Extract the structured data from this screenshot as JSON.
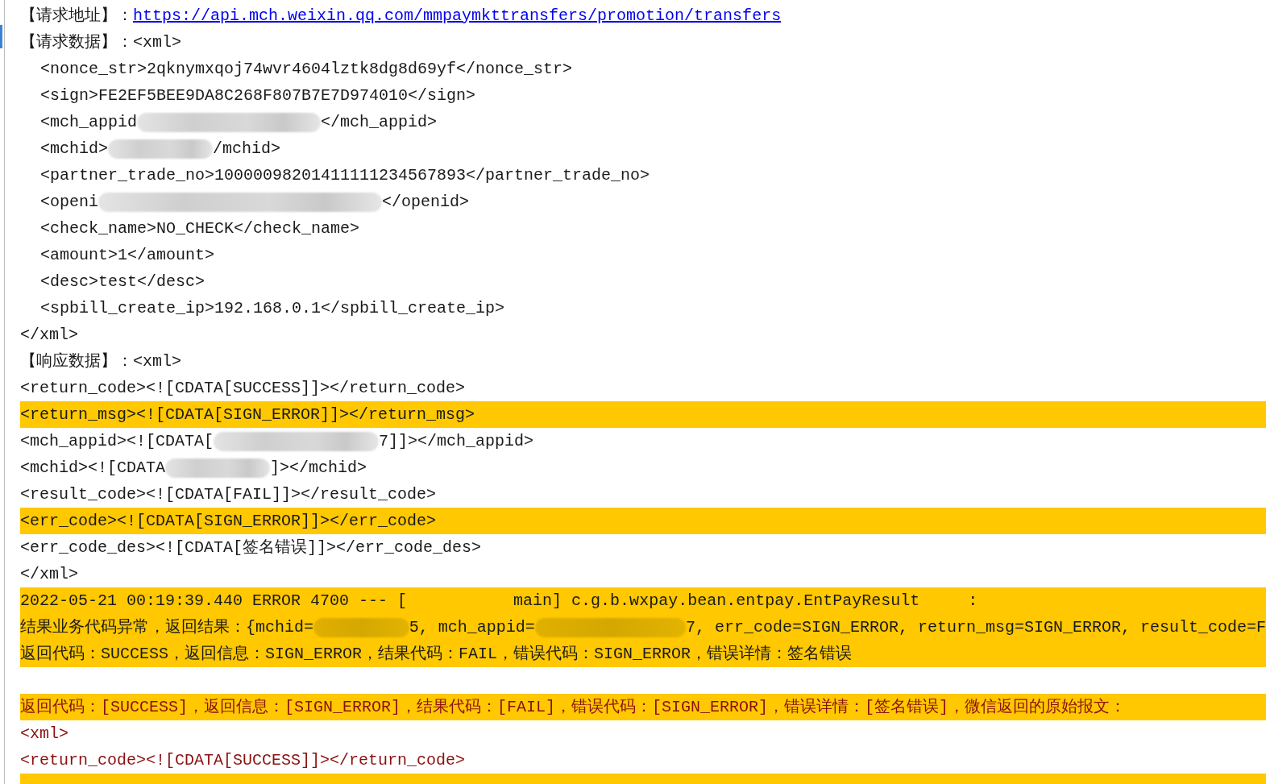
{
  "lines": [
    {
      "kind": "normal",
      "highlighted": false,
      "indented": false,
      "segments": [
        {
          "kind": "text",
          "text": "【请求地址】："
        },
        {
          "kind": "link",
          "text": "https://api.mch.weixin.qq.com/mmpaymkttransfers/promotion/transfers"
        }
      ]
    },
    {
      "kind": "normal",
      "highlighted": false,
      "indented": false,
      "segments": [
        {
          "kind": "text",
          "text": "【请求数据】：<xml>"
        }
      ]
    },
    {
      "kind": "normal",
      "highlighted": false,
      "indented": true,
      "segments": [
        {
          "kind": "text",
          "text": "<nonce_str>2qknymxqoj74wvr4604lztk8dg8d69yf</nonce_str>"
        }
      ]
    },
    {
      "kind": "normal",
      "highlighted": false,
      "indented": true,
      "segments": [
        {
          "kind": "text",
          "text": "<sign>FE2EF5BEE9DA8C268F807B7E7D974010</sign>"
        }
      ]
    },
    {
      "kind": "normal",
      "highlighted": false,
      "indented": true,
      "segments": [
        {
          "kind": "text",
          "text": "<mch_appid"
        },
        {
          "kind": "largeblur"
        },
        {
          "kind": "text",
          "text": "</mch_appid>"
        }
      ]
    },
    {
      "kind": "normal",
      "highlighted": false,
      "indented": true,
      "segments": [
        {
          "kind": "text",
          "text": "<mchid>"
        },
        {
          "kind": "smallblur"
        },
        {
          "kind": "text",
          "text": "/mchid>"
        }
      ]
    },
    {
      "kind": "normal",
      "highlighted": false,
      "indented": true,
      "segments": [
        {
          "kind": "text",
          "text": "<partner_trade_no>10000098201411111234567893</partner_trade_no>"
        }
      ]
    },
    {
      "kind": "normal",
      "highlighted": false,
      "indented": true,
      "segments": [
        {
          "kind": "text",
          "text": "<openi"
        },
        {
          "kind": "hugeblur"
        },
        {
          "kind": "text",
          "text": "</openid>"
        }
      ]
    },
    {
      "kind": "normal",
      "highlighted": false,
      "indented": true,
      "segments": [
        {
          "kind": "text",
          "text": "<check_name>NO_CHECK</check_name>"
        }
      ]
    },
    {
      "kind": "normal",
      "highlighted": false,
      "indented": true,
      "segments": [
        {
          "kind": "text",
          "text": "<amount>1</amount>"
        }
      ]
    },
    {
      "kind": "normal",
      "highlighted": false,
      "indented": true,
      "segments": [
        {
          "kind": "text",
          "text": "<desc>test</desc>"
        }
      ]
    },
    {
      "kind": "normal",
      "highlighted": false,
      "indented": true,
      "segments": [
        {
          "kind": "text",
          "text": "<spbill_create_ip>192.168.0.1</spbill_create_ip>"
        }
      ]
    },
    {
      "kind": "normal",
      "highlighted": false,
      "indented": false,
      "segments": [
        {
          "kind": "text",
          "text": "</xml>"
        }
      ]
    },
    {
      "kind": "normal",
      "highlighted": false,
      "indented": false,
      "segments": [
        {
          "kind": "text",
          "text": "【响应数据】：<xml>"
        }
      ]
    },
    {
      "kind": "normal",
      "highlighted": false,
      "indented": false,
      "segments": [
        {
          "kind": "text",
          "text": "<return_code><![CDATA[SUCCESS]]></return_code>"
        }
      ]
    },
    {
      "kind": "normal",
      "highlighted": true,
      "indented": false,
      "segments": [
        {
          "kind": "text",
          "text": "<return_msg><![CDATA[SIGN_ERROR]]></return_msg>"
        }
      ]
    },
    {
      "kind": "normal",
      "highlighted": false,
      "indented": false,
      "segments": [
        {
          "kind": "text",
          "text": "<mch_appid><![CDATA["
        },
        {
          "kind": "mediumblur"
        },
        {
          "kind": "text",
          "text": "7]]></mch_appid>"
        }
      ]
    },
    {
      "kind": "normal",
      "highlighted": false,
      "indented": false,
      "segments": [
        {
          "kind": "text",
          "text": "<mchid><![CDATA"
        },
        {
          "kind": "smallblur"
        },
        {
          "kind": "text",
          "text": "]></mchid>"
        }
      ]
    },
    {
      "kind": "normal",
      "highlighted": false,
      "indented": false,
      "segments": [
        {
          "kind": "text",
          "text": "<result_code><![CDATA[FAIL]]></result_code>"
        }
      ]
    },
    {
      "kind": "normal",
      "highlighted": true,
      "indented": false,
      "segments": [
        {
          "kind": "text",
          "text": "<err_code><![CDATA[SIGN_ERROR]]></err_code>"
        }
      ]
    },
    {
      "kind": "normal",
      "highlighted": false,
      "indented": false,
      "segments": [
        {
          "kind": "text",
          "text": "<err_code_des><![CDATA[签名错误]]></err_code_des>"
        }
      ]
    },
    {
      "kind": "normal",
      "highlighted": false,
      "indented": false,
      "segments": [
        {
          "kind": "text",
          "text": "</xml>"
        }
      ]
    },
    {
      "kind": "normal",
      "highlighted": true,
      "indented": false,
      "segments": [
        {
          "kind": "text",
          "text": "2022-05-21 00:19:39.440 ERROR 4700 --- [           main] c.g.b.wxpay.bean.entpay.EntPayResult     :"
        }
      ]
    },
    {
      "kind": "normal",
      "highlighted": true,
      "indented": false,
      "segments": [
        {
          "kind": "text",
          "text": "结果业务代码异常，返回结果：{mchid="
        },
        {
          "kind": "smallblur"
        },
        {
          "kind": "text",
          "text": "5, mch_appid="
        },
        {
          "kind": "mediumblur"
        },
        {
          "kind": "text",
          "text": "7, err_code=SIGN_ERROR, return_msg=SIGN_ERROR, result_code=F"
        }
      ]
    },
    {
      "kind": "normal",
      "highlighted": true,
      "indented": false,
      "segments": [
        {
          "kind": "text",
          "text": "返回代码：SUCCESS，返回信息：SIGN_ERROR，结果代码：FAIL，错误代码：SIGN_ERROR，错误详情：签名错误"
        }
      ]
    },
    {
      "kind": "normal",
      "highlighted": false
    },
    {
      "kind": "error",
      "highlighted": true,
      "indented": false,
      "segments": [
        {
          "kind": "text",
          "text": "返回代码：[SUCCESS]，返回信息：[SIGN_ERROR]，结果代码：[FAIL]，错误代码：[SIGN_ERROR]，错误详情：[签名错误]，微信返回的原始报文："
        }
      ]
    },
    {
      "kind": "error",
      "highlighted": false,
      "indented": false,
      "segments": [
        {
          "kind": "text",
          "text": "<xml>"
        }
      ]
    },
    {
      "kind": "error",
      "highlighted": false,
      "indented": false,
      "segments": [
        {
          "kind": "text",
          "text": "<return_code><![CDATA[SUCCESS]]></return_code>"
        }
      ]
    },
    {
      "kind": "error",
      "highlighted": true
    }
  ]
}
